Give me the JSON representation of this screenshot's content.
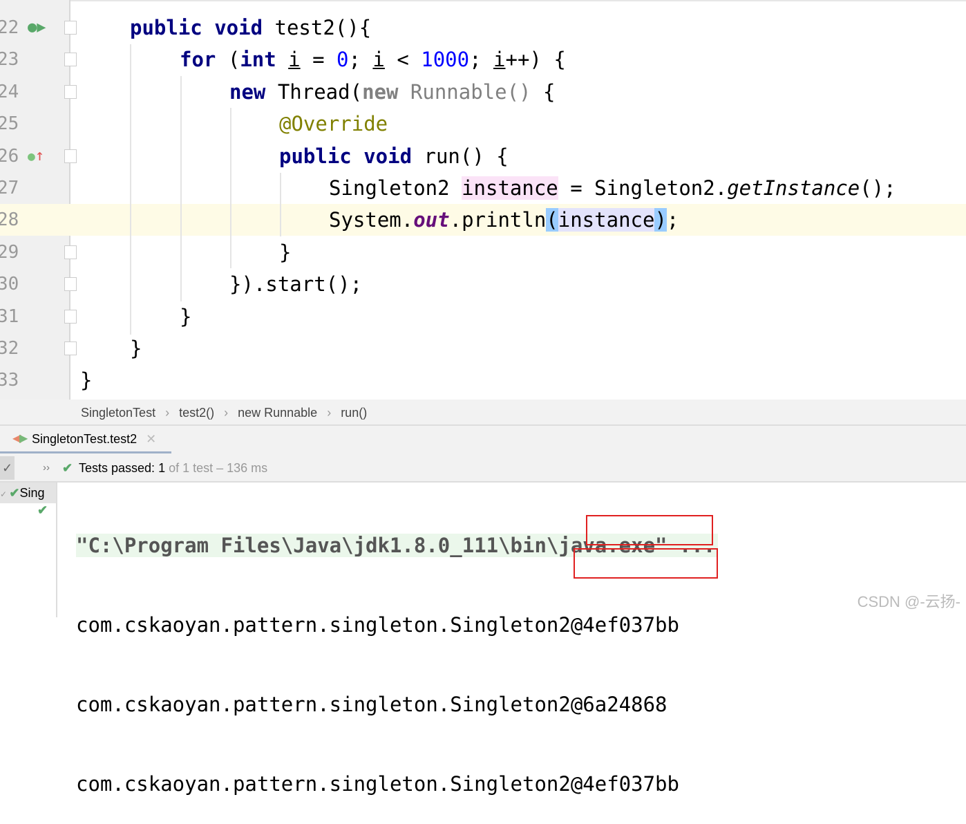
{
  "editor": {
    "lines": [
      {
        "n": "22",
        "icon": "run-test",
        "fold": "down",
        "indent": 1,
        "tokens": [
          [
            "public void ",
            "kw"
          ],
          [
            "test2(){",
            ""
          ]
        ]
      },
      {
        "n": "23",
        "fold": "down",
        "indent": 2,
        "tokens": [
          [
            "for ",
            "kw"
          ],
          [
            "(",
            ""
          ],
          [
            "int ",
            "kw"
          ],
          [
            "i",
            "ul"
          ],
          [
            " = ",
            ""
          ],
          [
            "0",
            "num"
          ],
          [
            "; ",
            ""
          ],
          [
            "i",
            "ul"
          ],
          [
            " < ",
            ""
          ],
          [
            "1000",
            "num"
          ],
          [
            "; ",
            ""
          ],
          [
            "i",
            "ul"
          ],
          [
            "++) {",
            ""
          ]
        ]
      },
      {
        "n": "24",
        "fold": "down",
        "indent": 3,
        "tokens": [
          [
            "new ",
            "kw"
          ],
          [
            "Thread(",
            ""
          ],
          [
            "new ",
            "kw gray"
          ],
          [
            "Runnable() ",
            "gray"
          ],
          [
            "{",
            ""
          ]
        ]
      },
      {
        "n": "25",
        "indent": 4,
        "tokens": [
          [
            "@Override",
            "ann"
          ]
        ]
      },
      {
        "n": "26",
        "icon": "implements",
        "fold": "down",
        "indent": 4,
        "tokens": [
          [
            "public void ",
            "kw"
          ],
          [
            "run() {",
            ""
          ]
        ]
      },
      {
        "n": "27",
        "indent": 5,
        "tokens": [
          [
            "Singleton2 ",
            ""
          ],
          [
            "instance",
            "hlpink"
          ],
          [
            " = Singleton2.",
            ""
          ],
          [
            "getInstance",
            "it"
          ],
          [
            "();",
            ""
          ]
        ]
      },
      {
        "n": "28",
        "indent": 5,
        "current": true,
        "tokens": [
          [
            "System.",
            ""
          ],
          [
            "out",
            "static"
          ],
          [
            ".println",
            ""
          ],
          [
            "(",
            "brace"
          ],
          [
            "instance",
            "hlblue"
          ],
          [
            ")",
            "brace"
          ],
          [
            ";",
            ""
          ]
        ]
      },
      {
        "n": "29",
        "fold": "up",
        "indent": 4,
        "tokens": [
          [
            "}",
            ""
          ]
        ]
      },
      {
        "n": "30",
        "fold": "up",
        "indent": 3,
        "tokens": [
          [
            "}).start();",
            ""
          ]
        ]
      },
      {
        "n": "31",
        "fold": "up",
        "indent": 2,
        "tokens": [
          [
            "}",
            ""
          ]
        ]
      },
      {
        "n": "32",
        "fold": "up",
        "indent": 1,
        "tokens": [
          [
            "}",
            ""
          ]
        ]
      },
      {
        "n": "33",
        "indent": 0,
        "tokens": [
          [
            "}",
            ""
          ]
        ]
      }
    ]
  },
  "breadcrumb": [
    "SingletonTest",
    "test2()",
    "new Runnable",
    "run()"
  ],
  "run_tab": {
    "label": "SingletonTest.test2"
  },
  "test_status": {
    "prefix": "Tests passed: ",
    "count": "1",
    "rest": " of 1 test – 136 ms"
  },
  "tree": {
    "root": "Sing"
  },
  "console": {
    "command": "\"C:\\Program Files\\Java\\jdk1.8.0_111\\bin\\java.exe\" ...",
    "output": [
      "com.cskaoyan.pattern.singleton.Singleton2@4ef037bb",
      "com.cskaoyan.pattern.singleton.Singleton2@6a24868",
      "com.cskaoyan.pattern.singleton.Singleton2@4ef037bb"
    ]
  },
  "watermark": "CSDN @-云扬-",
  "colors": {
    "keyword": "#000080",
    "number": "#0000ff",
    "annotation": "#808000",
    "pass": "#59a869",
    "highlight_box": "#e02020"
  }
}
